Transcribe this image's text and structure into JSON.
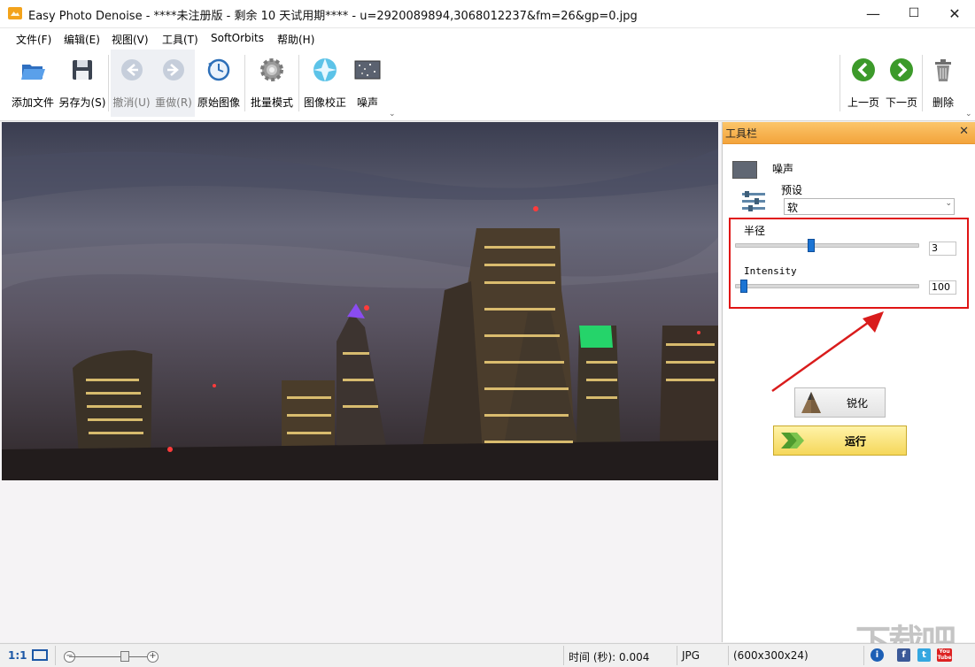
{
  "window": {
    "title": "Easy Photo Denoise - ****未注册版 - 剩余 10 天试用期**** - u=2920089894,3068012237&fm=26&gp=0.jpg",
    "minimize": "—",
    "maximize": "☐",
    "close": "✕"
  },
  "menu": [
    "文件(F)",
    "编辑(E)",
    "视图(V)",
    "工具(T)",
    "SoftOrbits",
    "帮助(H)"
  ],
  "toolbar": {
    "add_file": "添加文件",
    "save_as": "另存为(S)",
    "undo": "撤消(U)",
    "redo": "重做(R)",
    "original": "原始图像",
    "batch": "批量模式",
    "correction": "图像校正",
    "noise": "噪声",
    "prev": "上一页",
    "next": "下一页",
    "delete": "删除"
  },
  "panel": {
    "title": "工具栏",
    "close": "✕",
    "noise_label": "噪声",
    "preset_label": "预设",
    "preset_value": "软",
    "radius_label": "半径",
    "radius_value": "3",
    "radius_fraction": 0.4,
    "intensity_label": "Intensity",
    "intensity_value": "100",
    "intensity_fraction": 0.03,
    "sharpen_button": "锐化",
    "run_button": "运行"
  },
  "status": {
    "zoom_1to1": "1:1",
    "time": "时间 (秒): 0.004",
    "format": "JPG",
    "dimensions": "(600x300x24)",
    "social_facebook": "f",
    "social_twitter": "t",
    "social_youtube": "You Tube"
  },
  "colors": {
    "panel_header": "#f3a43c",
    "highlight": "#e01414",
    "slider_thumb": "#1b74d4",
    "run_button": "#f5d75a"
  },
  "watermark": "下载吧"
}
